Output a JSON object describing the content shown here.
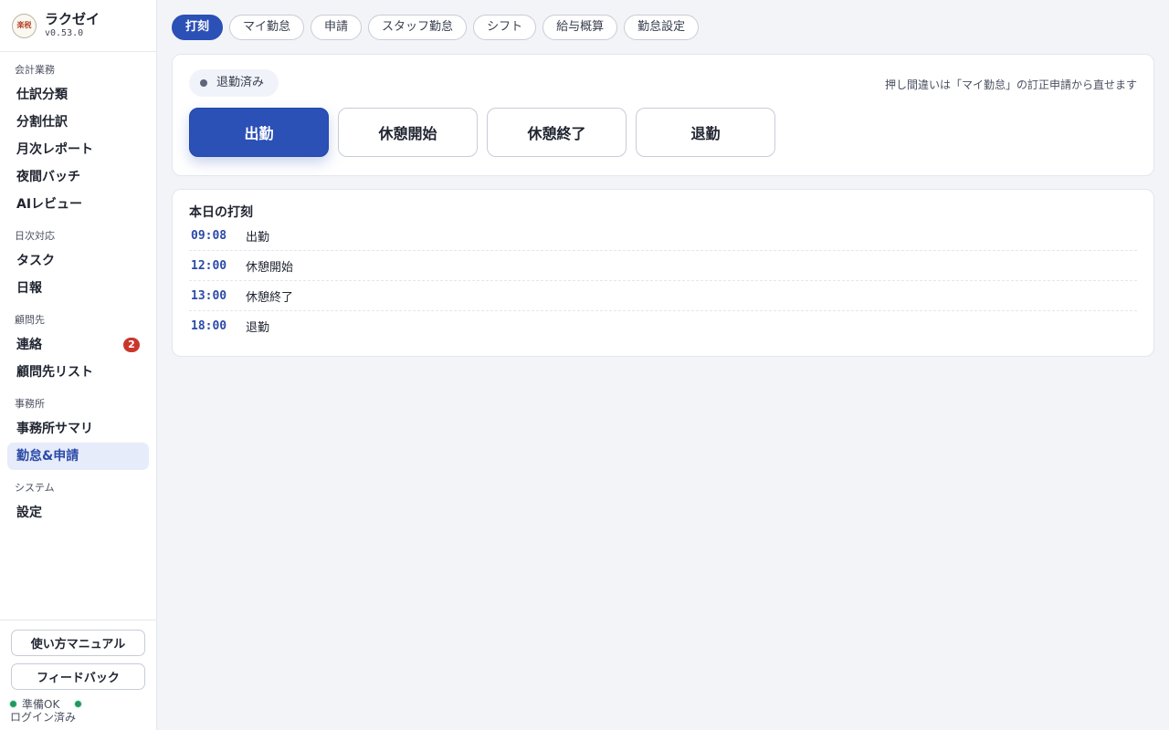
{
  "brand": {
    "name": "ラクゼイ",
    "version": "v0.53.0",
    "logo_text": "楽税"
  },
  "sidebar": {
    "sections": [
      {
        "title": "会計業務",
        "items": [
          "仕訳分類",
          "分割仕訳",
          "月次レポート",
          "夜間バッチ",
          "AIレビュー"
        ]
      },
      {
        "title": "日次対応",
        "items": [
          "タスク",
          "日報"
        ]
      },
      {
        "title": "顧問先",
        "items": [
          "連絡",
          "顧問先リスト"
        ],
        "badge": "2"
      },
      {
        "title": "事務所",
        "items": [
          "事務所サマリ",
          "勤怠&申請"
        ]
      },
      {
        "title": "システム",
        "items": [
          "設定"
        ]
      }
    ],
    "active_item": "勤怠&申請"
  },
  "bottom": {
    "manual_label": "使い方マニュアル",
    "feedback_label": "フィードバック",
    "status_label": "準備OK",
    "login_label": "ログイン済み"
  },
  "tabs": [
    "打刻",
    "マイ勤怠",
    "申請",
    "スタッフ勤怠",
    "シフト",
    "給与概算",
    "勤怠設定"
  ],
  "active_tab": "打刻",
  "punch": {
    "state_label": "退勤済み",
    "hint": "押し間違いは「マイ勤怠」の訂正申請から直せます",
    "buttons": [
      "出勤",
      "休憩開始",
      "休憩終了",
      "退勤"
    ]
  },
  "log": {
    "title": "本日の打刻",
    "entries": [
      {
        "time": "09:08",
        "label": "出勤"
      },
      {
        "time": "12:00",
        "label": "休憩開始"
      },
      {
        "time": "13:00",
        "label": "休憩終了"
      },
      {
        "time": "18:00",
        "label": "退勤"
      }
    ]
  },
  "colors": {
    "accent": "#2b50b6",
    "badge": "#c9372c",
    "status_ok": "#1d9a5e"
  }
}
